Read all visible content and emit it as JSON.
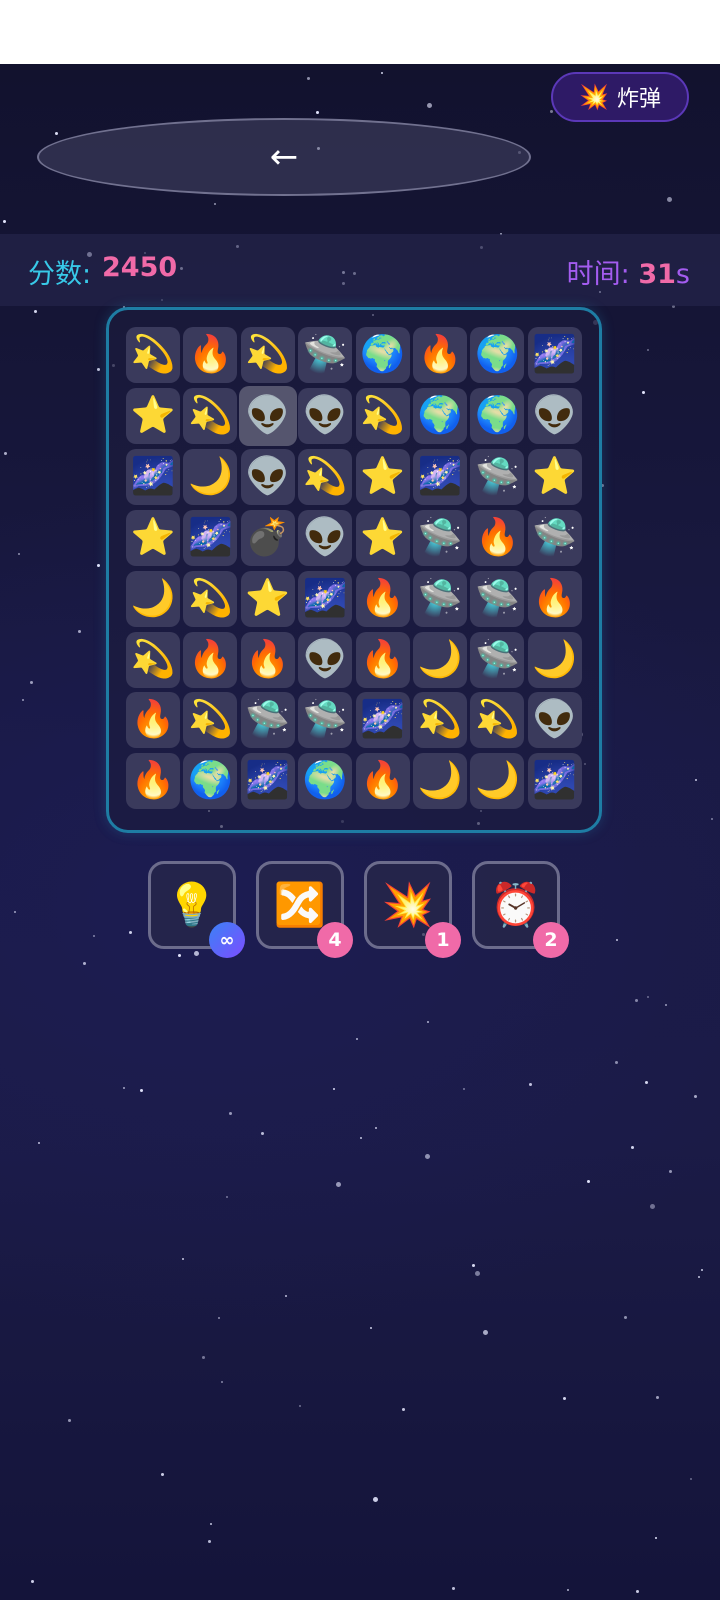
{
  "header": {
    "back_label": "←",
    "bomb_icon": "💥",
    "bomb_label": "炸弹"
  },
  "scorebar": {
    "score_label": "分数:",
    "score_value": "2450",
    "time_label": "时间:",
    "time_value": "31",
    "time_unit": "s"
  },
  "board": {
    "rows": [
      [
        "💫",
        "🔥",
        "💫",
        "🛸",
        "🌍",
        "🔥",
        "🌍",
        "🌌"
      ],
      [
        "⭐",
        "💫",
        "👽",
        "👽",
        "💫",
        "🌍",
        "🌍",
        "👽"
      ],
      [
        "🌌",
        "🌙",
        "👽",
        "💫",
        "⭐",
        "🌌",
        "🛸",
        "⭐"
      ],
      [
        "⭐",
        "🌌",
        "💣",
        "👽",
        "⭐",
        "🛸",
        "🔥",
        "🛸"
      ],
      [
        "🌙",
        "💫",
        "⭐",
        "🌌",
        "🔥",
        "🛸",
        "🛸",
        "🔥"
      ],
      [
        "💫",
        "🔥",
        "🔥",
        "👽",
        "🔥",
        "🌙",
        "🛸",
        "🌙"
      ],
      [
        "🔥",
        "💫",
        "🛸",
        "🛸",
        "🌌",
        "💫",
        "💫",
        "👽"
      ],
      [
        "🔥",
        "🌍",
        "🌌",
        "🌍",
        "🔥",
        "🌙",
        "🌙",
        "🌌"
      ]
    ],
    "selected": [
      1,
      2
    ]
  },
  "tools": [
    {
      "name": "hint",
      "icon": "💡",
      "count": "∞"
    },
    {
      "name": "shuffle",
      "icon": "🔀",
      "count": "4"
    },
    {
      "name": "bomb",
      "icon": "💥",
      "count": "1"
    },
    {
      "name": "time",
      "icon": "⏰",
      "count": "2"
    }
  ],
  "colors": {
    "score_label": "#38c9e8",
    "score_value": "#f06aa8",
    "time_label": "#a45cf0",
    "board_border": "#1e7da4",
    "badge_pink": "#f06aa8"
  }
}
